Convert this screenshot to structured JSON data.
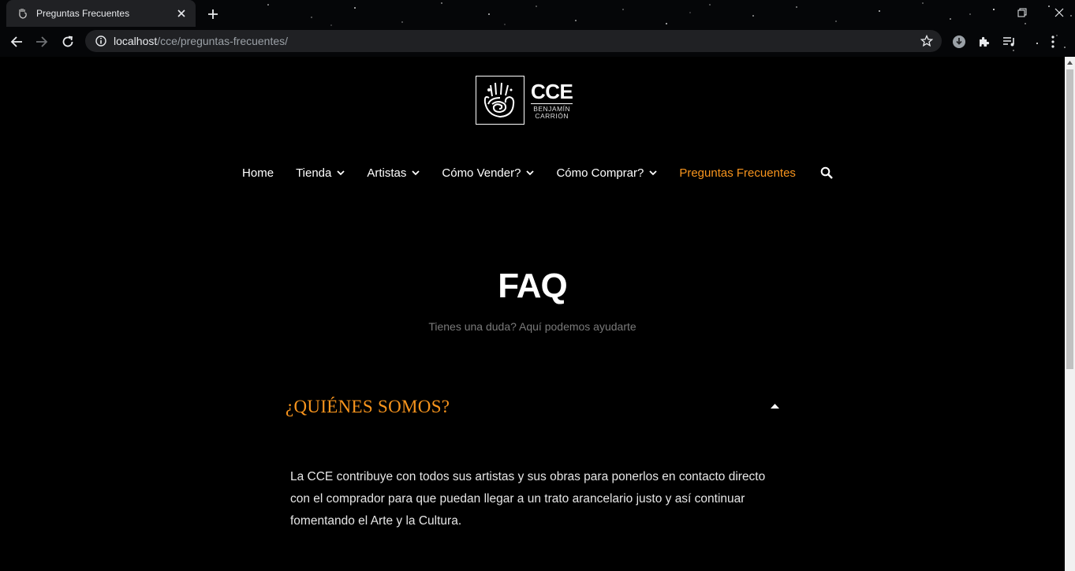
{
  "browser": {
    "tab_title": "Preguntas Frecuentes",
    "url_host": "localhost",
    "url_path": "/cce/preguntas-frecuentes/"
  },
  "site": {
    "logo": {
      "acronym": "CCE",
      "line1": "BENJAMÍN",
      "line2": "CARRIÓN"
    },
    "nav": [
      {
        "label": "Home",
        "dropdown": false,
        "active": false
      },
      {
        "label": "Tienda",
        "dropdown": true,
        "active": false
      },
      {
        "label": "Artistas",
        "dropdown": true,
        "active": false
      },
      {
        "label": "Cómo Vender?",
        "dropdown": true,
        "active": false
      },
      {
        "label": "Cómo Comprar?",
        "dropdown": true,
        "active": false
      },
      {
        "label": "Preguntas Frecuentes",
        "dropdown": false,
        "active": true
      }
    ],
    "accent_color": "#f7941d"
  },
  "hero": {
    "title": "FAQ",
    "subtitle": "Tienes una duda? Aquí podemos ayudarte"
  },
  "faq": [
    {
      "question": "¿QUIÉNES SOMOS?",
      "expanded": true,
      "answer": "La CCE contribuye con todos sus artistas y sus obras para ponerlos en contacto directo con el comprador para que puedan llegar a un trato arancelario justo y así continuar fomentando el Arte y la Cultura."
    }
  ]
}
